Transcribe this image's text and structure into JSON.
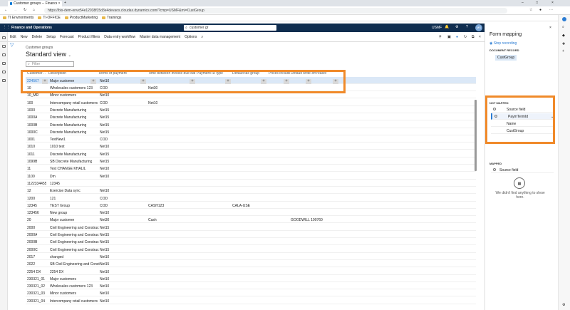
{
  "browser": {
    "tab_title": "Customer groups -- Finance and ...",
    "url": "https://bis-dem-envx54e12038f15d3e4devaos.cloudax.dynamics.com/?cmp=USMF&mi=CustGroup",
    "bookmarks": [
      "TI Environments",
      "TI-OFFICE",
      "ProductMarketing",
      "Trainings"
    ]
  },
  "app": {
    "name": "Finance and Operations",
    "search_value": "customer gr",
    "company": "USMF",
    "avatar": "MS"
  },
  "actions": [
    "Edit",
    "New",
    "Delete",
    "Setup",
    "Forecast",
    "Product filters",
    "Data entry workflow",
    "Master data management",
    "Options"
  ],
  "page": {
    "breadcrumb": "Customer groups",
    "view_title": "Standard view",
    "filter_placeholder": "Filter"
  },
  "grid": {
    "columns": [
      "Customer ...",
      "Description",
      "Terms of payment",
      "Time between invoice due date and ...",
      "Payment ID type",
      "Default tax group",
      "Prices include ...",
      "Default write-off reason"
    ],
    "selected": {
      "group": "224567",
      "description": "Major customer",
      "terms": "Net10"
    },
    "rows": [
      [
        "10",
        "Wholesales customers 123",
        "COD",
        "Net30",
        "",
        "",
        ""
      ],
      [
        "10_MR",
        "Minor customers",
        "Net10",
        "",
        "",
        "",
        ""
      ],
      [
        "100",
        "Intercompany retail customers",
        "COD",
        "Net10",
        "",
        "",
        ""
      ],
      [
        "1000",
        "Discrete Manufacturing",
        "Net15",
        "",
        "",
        "",
        ""
      ],
      [
        "1000A",
        "Discrete Manufacturing",
        "Net15",
        "",
        "",
        "",
        ""
      ],
      [
        "1000B",
        "Discrete Manufacturing",
        "Net15",
        "",
        "",
        "",
        ""
      ],
      [
        "1000C",
        "Discrete Manufacturing",
        "Net15",
        "",
        "",
        "",
        ""
      ],
      [
        "1001",
        "TestNew1",
        "COD",
        "",
        "",
        "",
        ""
      ],
      [
        "1010",
        "1010 test",
        "Net10",
        "",
        "",
        "",
        ""
      ],
      [
        "1011",
        "Discrete Manufacturing",
        "Net15",
        "",
        "",
        "",
        ""
      ],
      [
        "1099B",
        "SB Discrete Manufacturing",
        "Net15",
        "",
        "",
        "",
        ""
      ],
      [
        "11",
        "Test CHANGE KHALIL",
        "Net10",
        "",
        "",
        "",
        ""
      ],
      [
        "1100",
        "Dm",
        "Net10",
        "",
        "",
        "",
        ""
      ],
      [
        "1122334455",
        "12345",
        "",
        "",
        "",
        "",
        ""
      ],
      [
        "12",
        "Exercise Data sync",
        "Net10",
        "",
        "",
        "",
        ""
      ],
      [
        "1200",
        "121",
        "COD",
        "",
        "",
        "",
        ""
      ],
      [
        "12345",
        "TEST Group",
        "COD",
        "CASH123",
        "",
        "CALA-USE",
        ""
      ],
      [
        "123456",
        "New group",
        "Net10",
        "",
        "",
        "",
        ""
      ],
      [
        "20",
        "Major customer",
        "Net30",
        "Cash",
        "",
        "",
        "GOODWILL 100760"
      ],
      [
        "2000",
        "Civil Engineering and Construc",
        "Net15",
        "",
        "",
        "",
        ""
      ],
      [
        "2000A",
        "Civil Engineering and Construc",
        "Net15",
        "",
        "",
        "",
        ""
      ],
      [
        "2000B",
        "Civil Engineering and Construc",
        "Net15",
        "",
        "",
        "",
        ""
      ],
      [
        "2000C",
        "Civil Engineering and Construc",
        "Net15",
        "",
        "",
        "",
        ""
      ],
      [
        "2017",
        "changed",
        "Net10",
        "",
        "",
        "",
        ""
      ],
      [
        "2022",
        "SB Civil Engineering and Const",
        "Net15",
        "",
        "",
        "",
        ""
      ],
      [
        "2254 DX",
        "2254 DX",
        "Net10",
        "",
        "",
        "",
        ""
      ],
      [
        "230321_01",
        "Major customers",
        "Net10",
        "",
        "",
        "",
        ""
      ],
      [
        "230321_02",
        "Wholesales customers 123",
        "Net10",
        "",
        "",
        "",
        ""
      ],
      [
        "230321_03",
        "Minor customers",
        "Net10",
        "",
        "",
        "",
        ""
      ],
      [
        "230321_04",
        "Intercompany retail customers",
        "Net10",
        "",
        "",
        "",
        ""
      ]
    ]
  },
  "mapping": {
    "title": "Form mapping",
    "stop_recording": "Stop recording",
    "document_record_label": "DOCUMENT RECORD",
    "document_record": "CustGroup",
    "not_mapped_label": "NOT MAPPED",
    "source_field_header": "Source field",
    "not_mapped_fields": [
      "PaymTermId",
      "Name",
      "CustGroup"
    ],
    "mapped_label": "MAPPED",
    "empty_message": "We didn't find anything to show here."
  },
  "colors": {
    "accent": "#2b7cd3",
    "highlight": "#f08a2a",
    "header": "#0f2d4f"
  }
}
